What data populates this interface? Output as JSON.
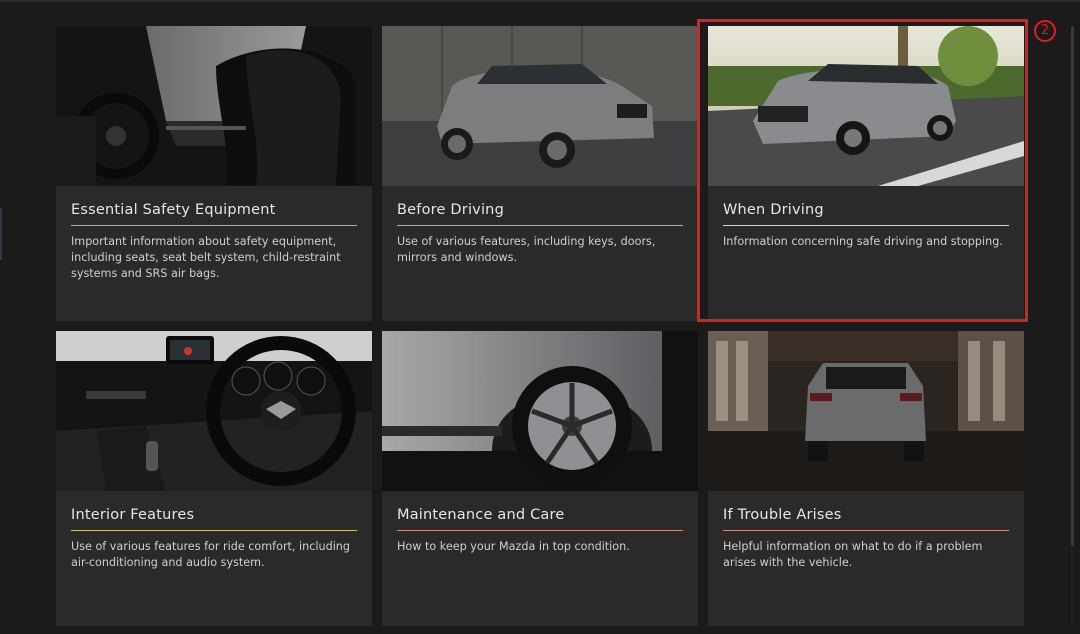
{
  "marker": {
    "label": "2"
  },
  "cards": [
    {
      "title": "Essential Safety Equipment",
      "description": "Important information about safety equipment, including seats, seat belt system, child-restraint systems and SRS air bags.",
      "accent": "#8fb7c9"
    },
    {
      "title": "Before Driving",
      "description": "Use of various features, including keys, doors, mirrors and windows.",
      "accent": "#8fb7c9"
    },
    {
      "title": "When Driving",
      "description": "Information concerning safe driving and stopping.",
      "accent": "#c9d6d9"
    },
    {
      "title": "Interior Features",
      "description": "Use of various features for ride comfort, including air-conditioning and audio system.",
      "accent": "#c9c16a"
    },
    {
      "title": "Maintenance and Care",
      "description": "How to keep your Mazda in top condition.",
      "accent": "#c98a7a"
    },
    {
      "title": "If Trouble Arises",
      "description": "Helpful information on what to do if a problem arises with the vehicle.",
      "accent": "#c98a7a"
    }
  ],
  "colors": {
    "highlight": "#e01e1e",
    "card_bg": "#2a2a2a",
    "page_bg": "#1b1b1b"
  }
}
